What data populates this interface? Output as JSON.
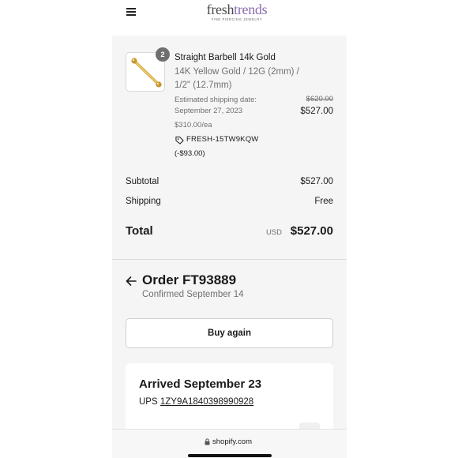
{
  "header": {
    "logo_prefix": "fresh",
    "logo_accent": "trends",
    "logo_tagline": "FINE PIERCING JEWELRY",
    "menu_icon": "hamburger-menu-icon"
  },
  "product": {
    "quantity": "2",
    "title": "Straight Barbell 14k Gold",
    "variant": "14K Yellow Gold / 12G (2mm) / 1/2\" (12.7mm)",
    "shipping_estimate": "Estimated shipping date: September 27, 2023",
    "original_price": "$620.00",
    "price": "$527.00",
    "unit_price": "$310.00/ea",
    "discount_code": "FRESH-15TW9KQW",
    "discount_amount": "(-$93.00)"
  },
  "summary": {
    "subtotal_label": "Subtotal",
    "subtotal_value": "$527.00",
    "shipping_label": "Shipping",
    "shipping_value": "Free",
    "total_label": "Total",
    "total_currency": "USD",
    "total_value": "$527.00"
  },
  "order": {
    "title": "Order FT93889",
    "confirmed": "Confirmed September 14",
    "buy_again_label": "Buy again"
  },
  "delivery": {
    "status": "Arrived September 23",
    "carrier": "UPS",
    "tracking_number": "1ZY9A1840398990928"
  },
  "browser": {
    "url": "shopify.com"
  },
  "colors": {
    "accent": "#8b6bb0",
    "background": "#f5f5f6",
    "muted_text": "#707070"
  }
}
